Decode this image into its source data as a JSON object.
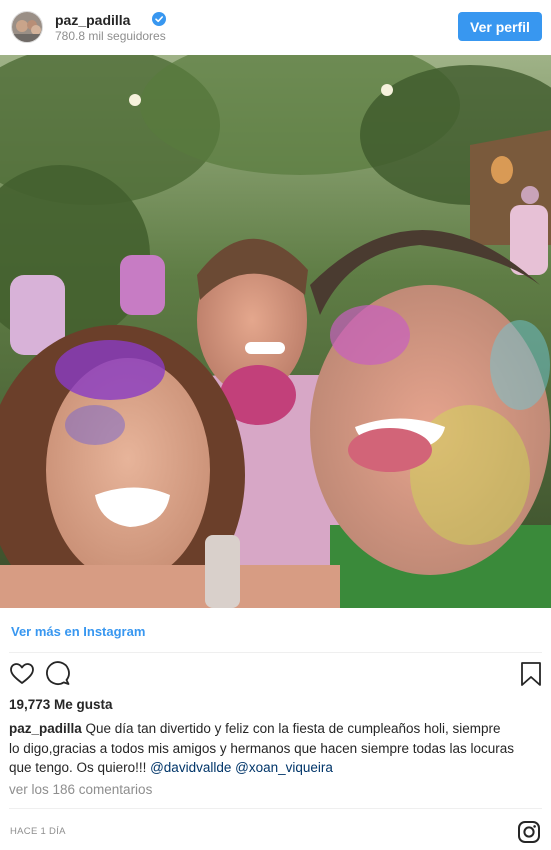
{
  "header": {
    "username": "paz_padilla",
    "followers": "780.8 mil seguidores",
    "profile_button": "Ver perfil"
  },
  "colors": {
    "accent": "#3897f0",
    "verified": "#3897f0",
    "mention": "#003569",
    "muted": "#8e8e8e",
    "text": "#262626"
  },
  "post": {
    "more_link": "Ver más en Instagram",
    "likes": "19,773 Me gusta",
    "caption": {
      "user": "paz_padilla",
      "text_line1": " Que día tan divertido y feliz con la fiesta de cumpleaños holi, siempre",
      "text_line2": "lo digo,gracias a todos mis amigos y hermanos que hacen siempre todas las locuras",
      "text_line3": "que tengo. Os quiero!!! ",
      "mention1": "@davidvallde",
      "mention2": "@xoan_viqueira"
    },
    "comments_link": "ver los 186 comentarios",
    "timestamp": "HACE 1 DÍA"
  },
  "icons": {
    "verified": "verified-badge-icon",
    "like": "heart-icon",
    "comment": "comment-bubble-icon",
    "save": "bookmark-icon",
    "brand": "instagram-logo-icon"
  }
}
